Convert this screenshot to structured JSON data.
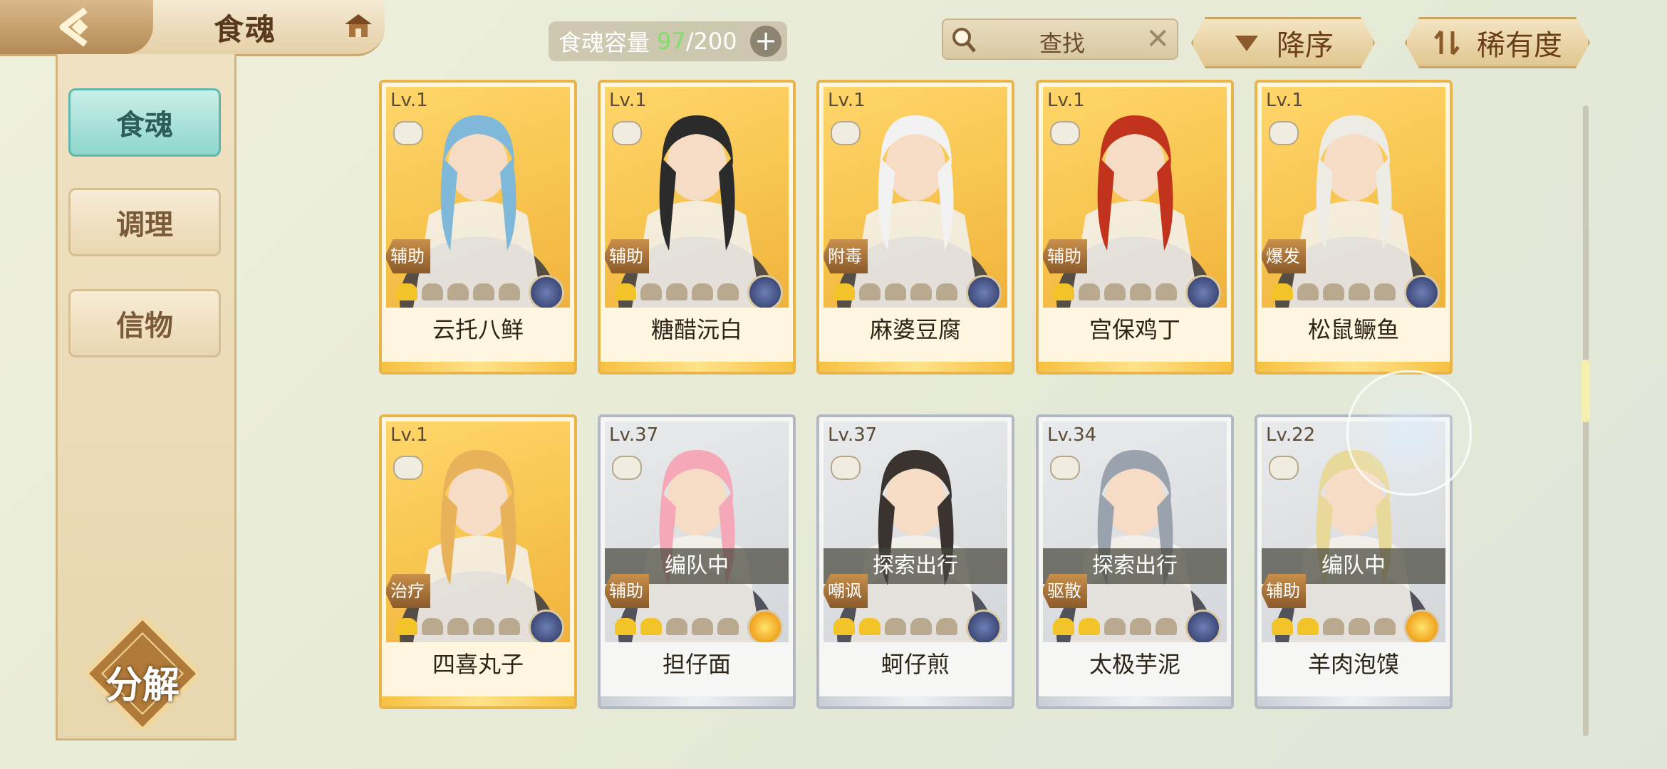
{
  "header": {
    "title": "食魂",
    "capacity_label": "食魂容量",
    "capacity_current": "97",
    "capacity_max": "/200",
    "search_placeholder": "查找",
    "sort_order_label": "降序",
    "sort_by_label": "稀有度"
  },
  "sidebar": {
    "tabs": [
      {
        "label": "食魂",
        "active": true
      },
      {
        "label": "调理",
        "active": false
      },
      {
        "label": "信物",
        "active": false
      }
    ],
    "decompose_label": "分解"
  },
  "colors": {
    "gold_frame": "#e9b54a",
    "silver_frame": "#b3b9c2",
    "accent_teal": "#8fd6cb",
    "capacity_green": "#7ee06a"
  },
  "cards": [
    {
      "level": "Lv.1",
      "role": "辅助",
      "name": "云托八鲜",
      "stars": 1,
      "frame": "gold",
      "element": "blue",
      "status": "",
      "hair": "#7fb8d8"
    },
    {
      "level": "Lv.1",
      "role": "辅助",
      "name": "糖醋沅白",
      "stars": 1,
      "frame": "gold",
      "element": "blue",
      "status": "",
      "hair": "#2b2b2b"
    },
    {
      "level": "Lv.1",
      "role": "附毒",
      "name": "麻婆豆腐",
      "stars": 1,
      "frame": "gold",
      "element": "blue",
      "status": "",
      "hair": "#f2f2f2"
    },
    {
      "level": "Lv.1",
      "role": "辅助",
      "name": "宫保鸡丁",
      "stars": 1,
      "frame": "gold",
      "element": "blue",
      "status": "",
      "hair": "#c2331e"
    },
    {
      "level": "Lv.1",
      "role": "爆发",
      "name": "松鼠鳜鱼",
      "stars": 1,
      "frame": "gold",
      "element": "blue",
      "status": "",
      "hair": "#ecebe4"
    },
    {
      "level": "Lv.1",
      "role": "治疗",
      "name": "四喜丸子",
      "stars": 1,
      "frame": "gold",
      "element": "blue",
      "status": "",
      "hair": "#e7b25a"
    },
    {
      "level": "Lv.37",
      "role": "辅助",
      "name": "担仔面",
      "stars": 2,
      "frame": "silver",
      "element": "gold",
      "status": "编队中",
      "hair": "#f4a8b8"
    },
    {
      "level": "Lv.37",
      "role": "嘲讽",
      "name": "蚵仔煎",
      "stars": 2,
      "frame": "silver",
      "element": "blue",
      "status": "探索出行",
      "hair": "#3a3330"
    },
    {
      "level": "Lv.34",
      "role": "驱散",
      "name": "太极芋泥",
      "stars": 2,
      "frame": "silver",
      "element": "blue",
      "status": "探索出行",
      "hair": "#9aa3ad"
    },
    {
      "level": "Lv.22",
      "role": "辅助",
      "name": "羊肉泡馍",
      "stars": 2,
      "frame": "silver",
      "element": "gold",
      "status": "编队中",
      "hair": "#e8d99a"
    }
  ]
}
